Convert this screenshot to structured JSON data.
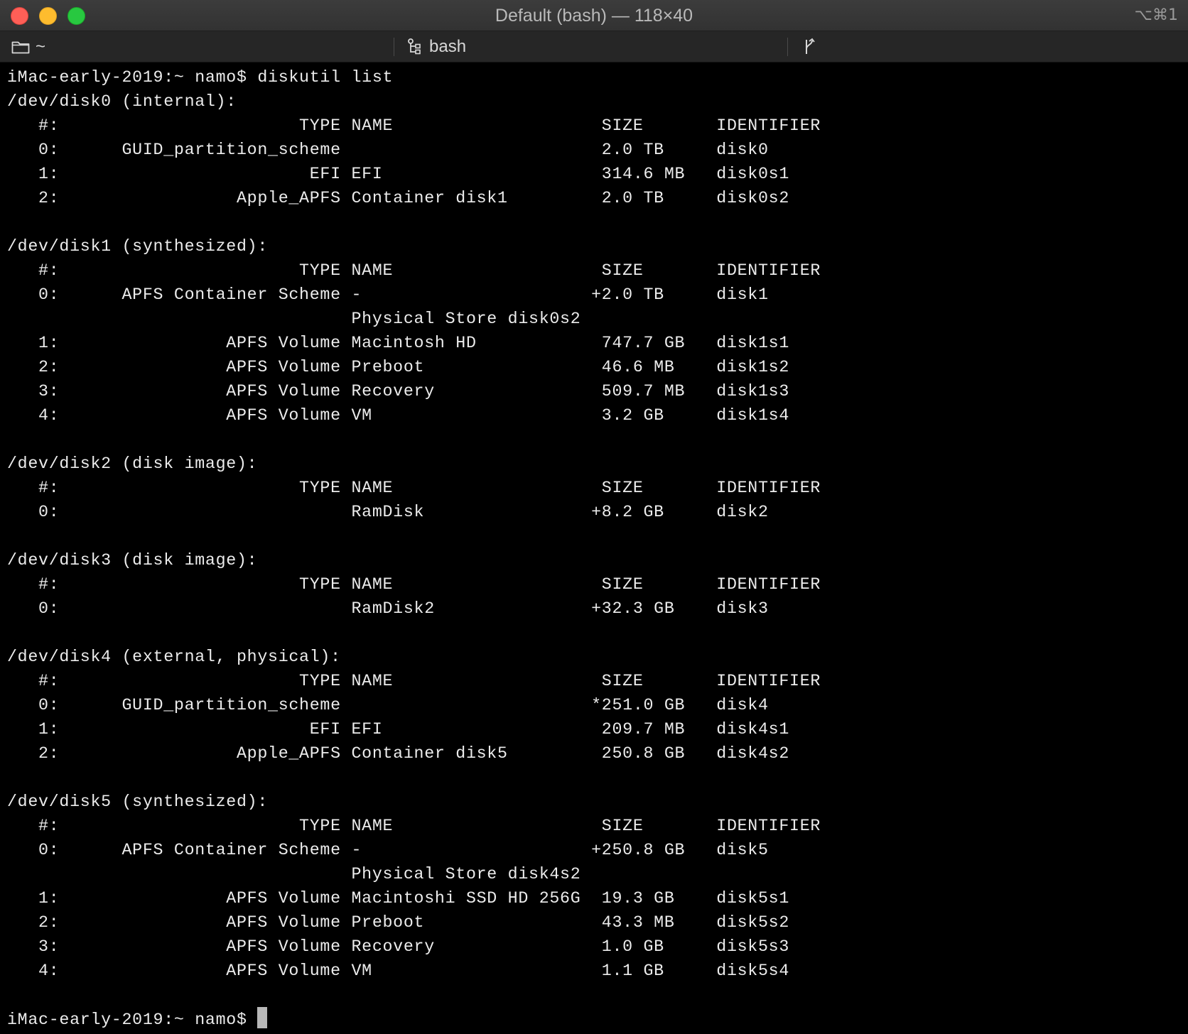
{
  "window": {
    "title": "Default (bash) — 118×40",
    "shortcut": "⌥⌘1"
  },
  "tabbar": {
    "cwd_label": "~",
    "process_label": "bash"
  },
  "terminal": {
    "command_line": "iMac-early-2019:~ namo$ diskutil list",
    "output_lines": [
      "/dev/disk0 (internal):",
      "   #:                       TYPE NAME                    SIZE       IDENTIFIER",
      "   0:      GUID_partition_scheme                         2.0 TB     disk0",
      "   1:                        EFI EFI                     314.6 MB   disk0s1",
      "   2:                 Apple_APFS Container disk1         2.0 TB     disk0s2",
      "",
      "/dev/disk1 (synthesized):",
      "   #:                       TYPE NAME                    SIZE       IDENTIFIER",
      "   0:      APFS Container Scheme -                      +2.0 TB     disk1",
      "                                 Physical Store disk0s2",
      "   1:                APFS Volume Macintosh HD            747.7 GB   disk1s1",
      "   2:                APFS Volume Preboot                 46.6 MB    disk1s2",
      "   3:                APFS Volume Recovery                509.7 MB   disk1s3",
      "   4:                APFS Volume VM                      3.2 GB     disk1s4",
      "",
      "/dev/disk2 (disk image):",
      "   #:                       TYPE NAME                    SIZE       IDENTIFIER",
      "   0:                            RamDisk                +8.2 GB     disk2",
      "",
      "/dev/disk3 (disk image):",
      "   #:                       TYPE NAME                    SIZE       IDENTIFIER",
      "   0:                            RamDisk2               +32.3 GB    disk3",
      "",
      "/dev/disk4 (external, physical):",
      "   #:                       TYPE NAME                    SIZE       IDENTIFIER",
      "   0:      GUID_partition_scheme                        *251.0 GB   disk4",
      "   1:                        EFI EFI                     209.7 MB   disk4s1",
      "   2:                 Apple_APFS Container disk5         250.8 GB   disk4s2",
      "",
      "/dev/disk5 (synthesized):",
      "   #:                       TYPE NAME                    SIZE       IDENTIFIER",
      "   0:      APFS Container Scheme -                      +250.8 GB   disk5",
      "                                 Physical Store disk4s2",
      "   1:                APFS Volume Macintoshi SSD HD 256G  19.3 GB    disk5s1",
      "   2:                APFS Volume Preboot                 43.3 MB    disk5s2",
      "   3:                APFS Volume Recovery                1.0 GB     disk5s3",
      "   4:                APFS Volume VM                      1.1 GB     disk5s4",
      ""
    ],
    "prompt": "iMac-early-2019:~ namo$ "
  }
}
